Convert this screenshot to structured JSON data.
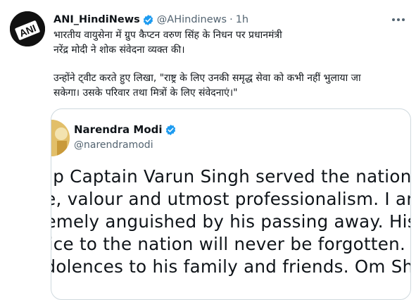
{
  "tweet": {
    "author_name": "ANI_HindiNews",
    "author_handle": "@AHindinews",
    "separator": "·",
    "time": "1h",
    "avatar_logo_text": "ANI",
    "text_lines": [
      "भारतीय वायुसेना में ग्रुप कैप्टन वरुण सिंह के निधन पर प्रधानमंत्री",
      "नरेंद्र मोदी ने शोक संवेदना व्यक्त की।"
    ],
    "quote_intro_lines": [
      "उन्होंने ट्वीट करते हुए लिखा, \"राष्ट्र के लिए उनकी समृद्ध सेवा को कभी नहीं भुलाया जा",
      "सकेगा। उसके परिवार तथा मित्रों के लिए संवेदनाएं।\""
    ]
  },
  "quoted_tweet": {
    "author_name": "Narendra Modi",
    "author_handle": "@narendramodi",
    "body_lines": [
      "Group Captain Varun Singh served the nation with",
      "pride, valour and utmost professionalism. I am",
      "extremely anguished by his passing away. His rich",
      "service to the nation will never be forgotten.",
      "Condolences to his family and friends. Om Shanti."
    ]
  },
  "colors": {
    "verified": "#1d9bf0",
    "muted": "#536471",
    "border": "#cfd9de"
  },
  "icons": {
    "verified": "verified-badge-icon",
    "more": "more-dots-icon"
  }
}
